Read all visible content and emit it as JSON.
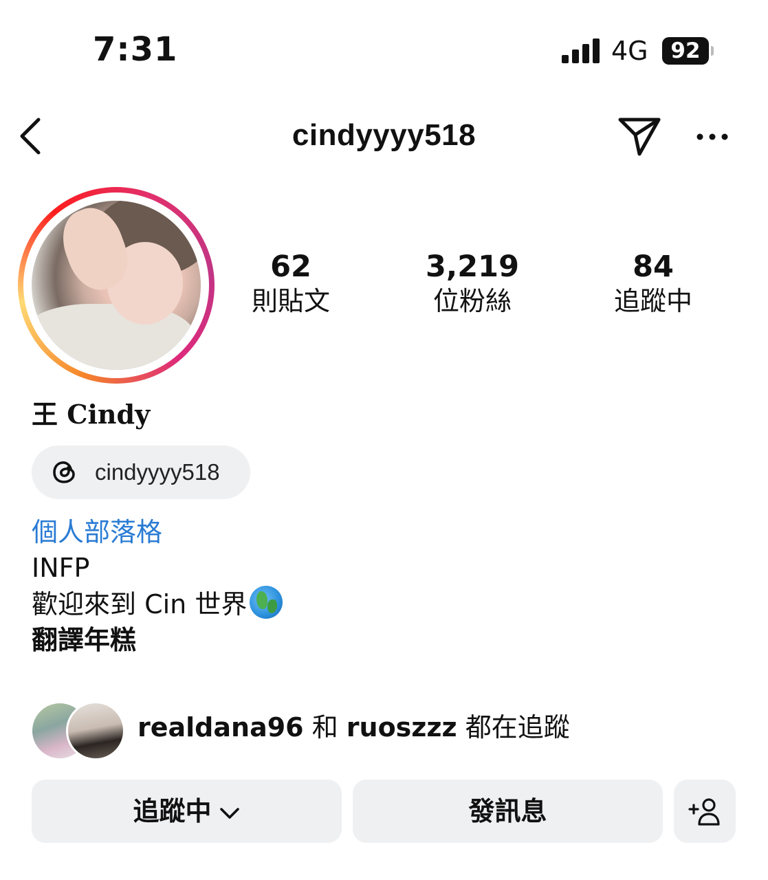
{
  "status_bar": {
    "time": "7:31",
    "network": "4G",
    "battery": "92"
  },
  "nav": {
    "username": "cindyyyy518"
  },
  "stats": {
    "posts_count": "62",
    "posts_label": "則貼文",
    "followers_count": "3,219",
    "followers_label": "位粉絲",
    "following_count": "84",
    "following_label": "追蹤中"
  },
  "profile": {
    "full_name": "王 Cindy",
    "threads_handle": "cindyyyy518",
    "bio_link": "個人部落格",
    "bio_line_1": "INFP",
    "bio_line_2": "歡迎來到 Cin 世界",
    "bio_line_3": "翻譯年糕"
  },
  "followed_by": {
    "user_1": "realdana96",
    "connector": " 和 ",
    "user_2": "ruoszzz",
    "suffix": " 都在追蹤"
  },
  "actions": {
    "following_label": "追蹤中",
    "message_label": "發訊息"
  },
  "icons": {
    "back": "chevron-left-icon",
    "send": "paper-plane-icon",
    "more": "ellipsis-icon",
    "threads": "threads-logo-icon",
    "globe": "globe-emoji-icon",
    "dropdown": "chevron-down-icon",
    "add_user": "add-person-icon"
  },
  "colors": {
    "link": "#2a7bd4",
    "button_bg": "#eff0f2",
    "story_ring": [
      "#f58529",
      "#feda75",
      "#dd2a7b",
      "#c13584"
    ]
  }
}
